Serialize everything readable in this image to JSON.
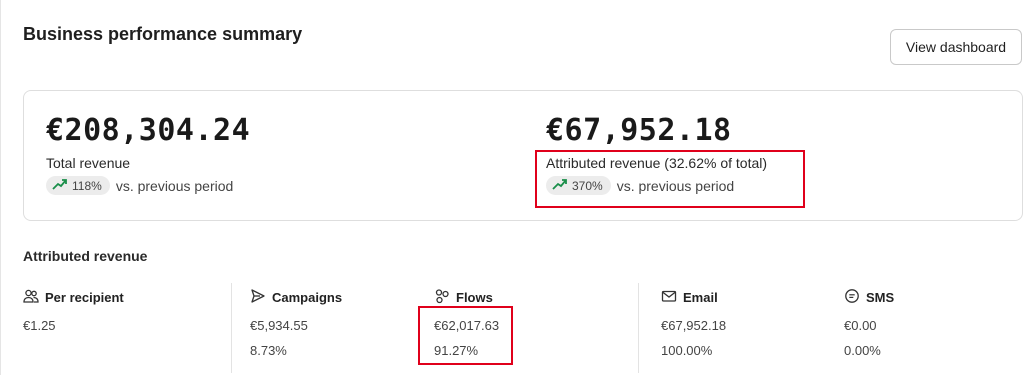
{
  "header": {
    "title": "Business performance summary",
    "view_dashboard_label": "View dashboard"
  },
  "summary": {
    "total_revenue": {
      "value": "€208,304.24",
      "label": "Total revenue",
      "change": "118%",
      "comparison": "vs. previous period"
    },
    "attributed_revenue": {
      "value": "€67,952.18",
      "label": "Attributed revenue (32.62% of total)",
      "change": "370%",
      "comparison": "vs. previous period"
    }
  },
  "attributed_section": {
    "title": "Attributed revenue",
    "columns": [
      {
        "label": "Per recipient",
        "icon": "people-icon",
        "value": "€1.25",
        "percent": ""
      },
      {
        "label": "Campaigns",
        "icon": "send-icon",
        "value": "€5,934.55",
        "percent": "8.73%"
      },
      {
        "label": "Flows",
        "icon": "flows-icon",
        "value": "€62,017.63",
        "percent": "91.27%"
      },
      {
        "label": "Email",
        "icon": "mail-icon",
        "value": "€67,952.18",
        "percent": "100.00%"
      },
      {
        "label": "SMS",
        "icon": "sms-icon",
        "value": "€0.00",
        "percent": "0.00%"
      }
    ]
  },
  "colors": {
    "trend_up": "#1a8f4a",
    "highlight": "#e0001b"
  }
}
